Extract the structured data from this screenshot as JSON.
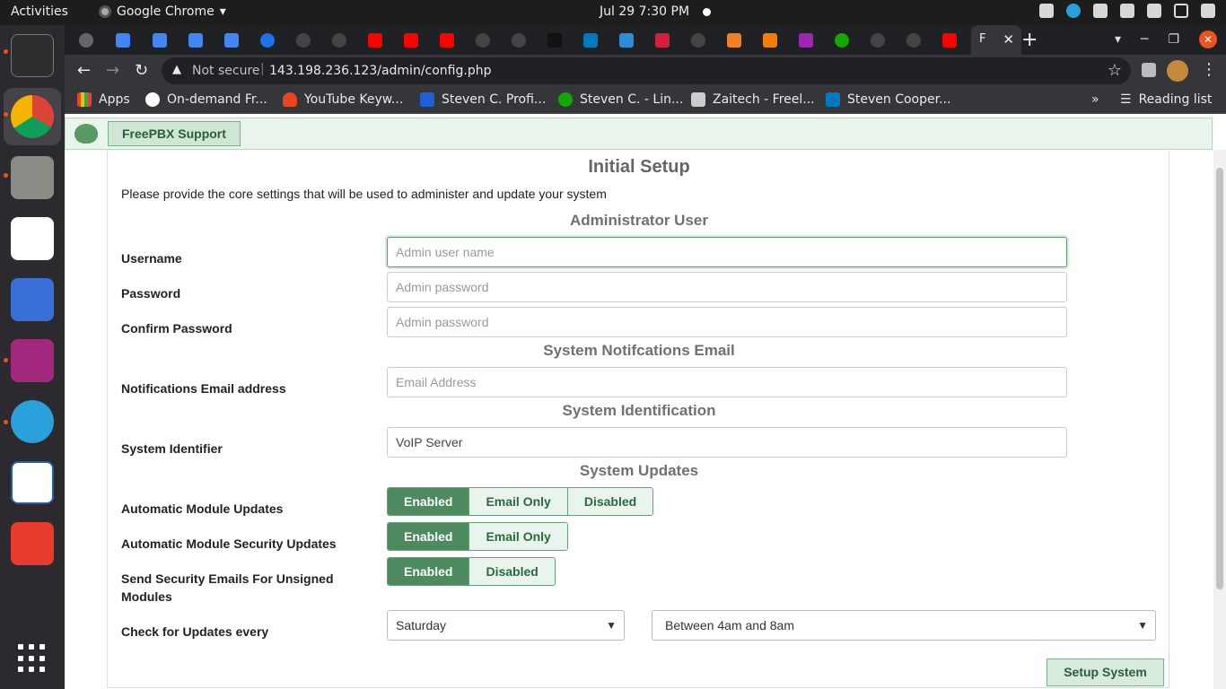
{
  "system": {
    "activities": "Activities",
    "app_name": "Google Chrome",
    "clock": "Jul 29  7:30 PM"
  },
  "browser": {
    "active_tab_favicon_text": "F",
    "security_label": "Not secure",
    "url": "143.198.236.123/admin/config.php",
    "bookmarks": [
      {
        "label": "Apps"
      },
      {
        "label": "On-demand Fr..."
      },
      {
        "label": "YouTube Keyw..."
      },
      {
        "label": "Steven C. Profi..."
      },
      {
        "label": "Steven C. - Lin..."
      },
      {
        "label": "Zaitech - Freel..."
      },
      {
        "label": "Steven Cooper..."
      }
    ],
    "reading_list": "Reading list",
    "overflow": "»"
  },
  "freepbx": {
    "support_button": "FreePBX Support"
  },
  "form": {
    "title": "Initial Setup",
    "description": "Please provide the core settings that will be used to administer and update your system",
    "sections": {
      "admin": "Administrator User",
      "notifications": "System Notifcations Email",
      "identification": "System Identification",
      "updates": "System Updates"
    },
    "labels": {
      "username": "Username",
      "password": "Password",
      "confirm_password": "Confirm Password",
      "notifications_email": "Notifications Email address",
      "system_identifier": "System Identifier",
      "auto_module_updates": "Automatic Module Updates",
      "auto_security_updates": "Automatic Module Security Updates",
      "security_emails": "Send Security Emails For Unsigned Modules",
      "check_updates": "Check for Updates every"
    },
    "placeholders": {
      "username": "Admin user name",
      "password": "Admin password",
      "confirm_password": "Admin password",
      "email": "Email Address"
    },
    "values": {
      "system_identifier": "VoIP Server",
      "check_day": "Saturday",
      "check_time": "Between 4am and 8am"
    },
    "toggles": {
      "auto_module_updates": [
        "Enabled",
        "Email Only",
        "Disabled"
      ],
      "auto_security_updates": [
        "Enabled",
        "Email Only"
      ],
      "security_emails": [
        "Enabled",
        "Disabled"
      ]
    },
    "selected_toggle": "Enabled",
    "submit": "Setup System"
  },
  "colors": {
    "accent": "#4d8a5e",
    "accent_light": "#e9f4ec"
  }
}
